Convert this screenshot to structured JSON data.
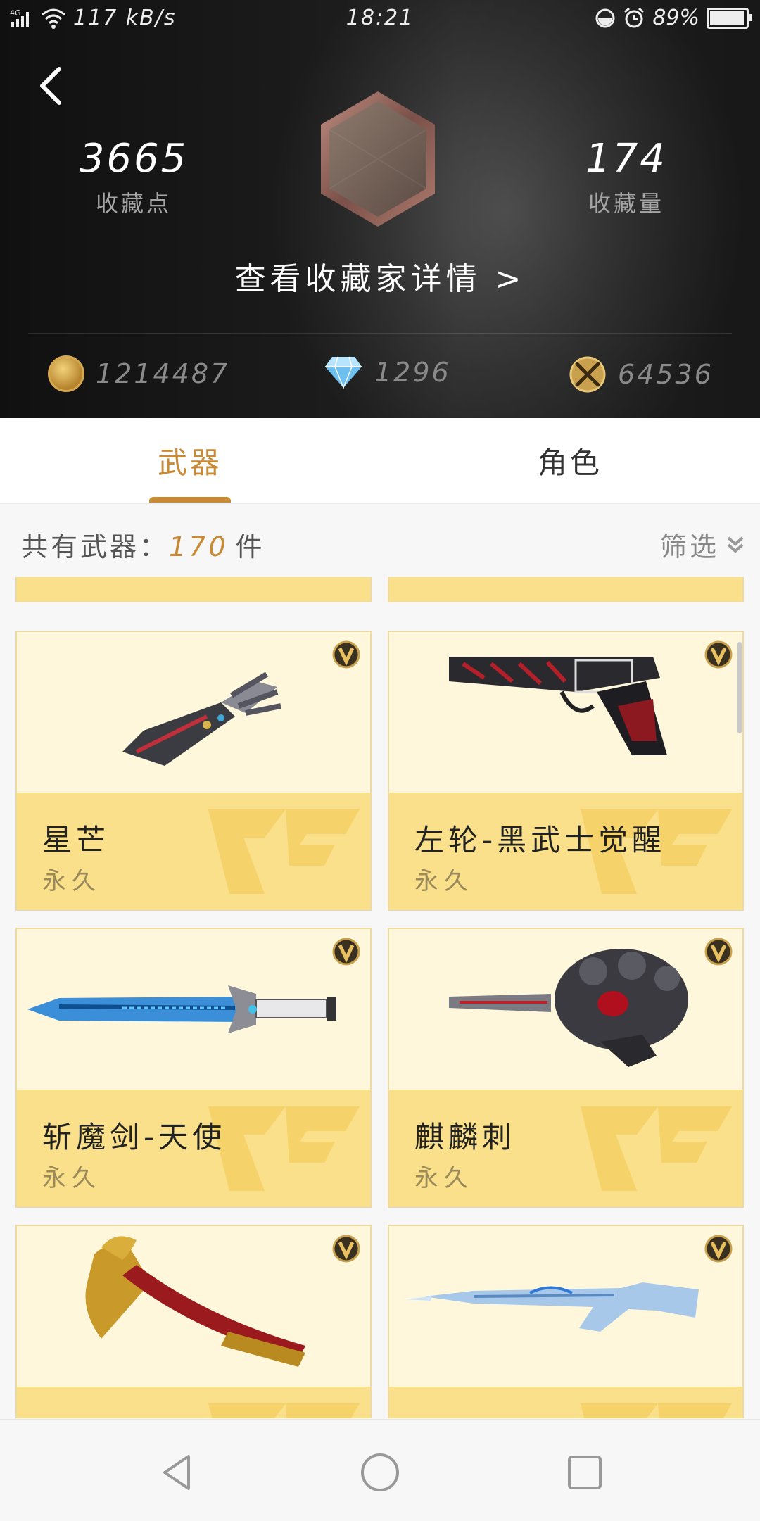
{
  "status_bar": {
    "network": "4G",
    "speed": "117 kB/s",
    "time": "18:21",
    "battery": "89%",
    "battery_level": 0.89
  },
  "header": {
    "collect_points": "3665",
    "collect_points_label": "收藏点",
    "collect_count": "174",
    "collect_count_label": "收藏量",
    "detail_link": "查看收藏家详情 >"
  },
  "currencies": [
    {
      "icon": "gold-coin-icon",
      "value": "1214487"
    },
    {
      "icon": "diamond-icon",
      "value": "1296"
    },
    {
      "icon": "crossed-swords-coin-icon",
      "value": "64536"
    }
  ],
  "tabs": [
    {
      "label": "武器",
      "active": true
    },
    {
      "label": "角色",
      "active": false
    }
  ],
  "summary": {
    "prefix": "共有武器：",
    "count": "170",
    "suffix": "件",
    "filter": "筛选"
  },
  "cards": [
    {
      "name": "星芒",
      "duration": "永久",
      "image": "gauntlet-icon"
    },
    {
      "name": "左轮-黑武士觉醒",
      "duration": "永久",
      "image": "revolver-icon"
    },
    {
      "name": "斩魔剑-天使",
      "duration": "永久",
      "image": "sword-icon"
    },
    {
      "name": "麒麟刺",
      "duration": "永久",
      "image": "knuckle-dagger-icon"
    },
    {
      "name": "",
      "duration": "",
      "image": "golden-axe-icon"
    },
    {
      "name": "",
      "duration": "",
      "image": "ice-rifle-icon"
    }
  ],
  "colors": {
    "accent": "#c88a36",
    "card_band": "#fae08a",
    "card_bg": "#fff7dc"
  }
}
